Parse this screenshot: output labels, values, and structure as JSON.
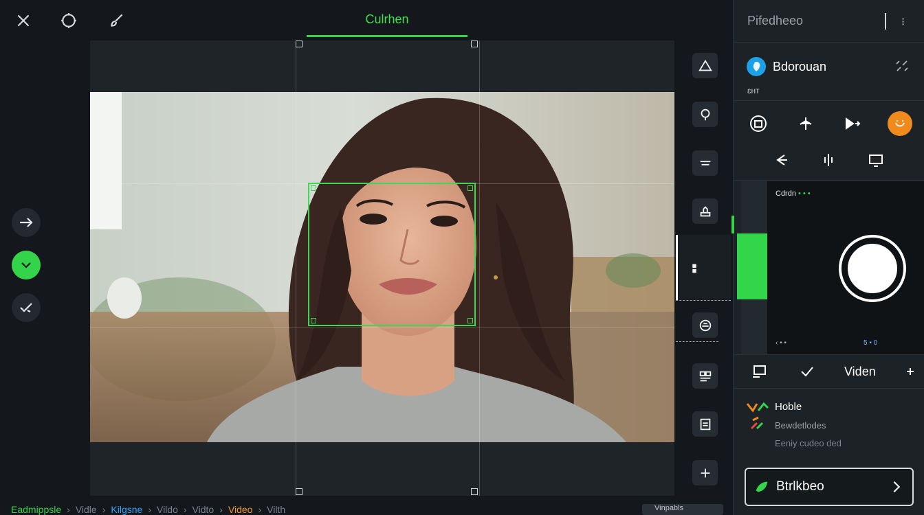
{
  "topbar": {
    "title": "Culrhen",
    "icons": [
      "close-icon",
      "ring-icon",
      "brush-icon"
    ]
  },
  "left_tools": [
    "arrow-right-icon",
    "chevron-down-icon",
    "check-swirl-icon"
  ],
  "right_tools": [
    "triangle-icon",
    "pin-icon",
    "lines-icon",
    "stamp-icon",
    "dots-icon",
    "face-icon",
    "layout-icon",
    "document-icon",
    "plus-icon"
  ],
  "panel": {
    "header": "Pifedheeo",
    "pin_symbol": "⁝",
    "account": {
      "name": "Bdorouan",
      "sub": "ɛнт"
    },
    "tools_row1": [
      "badge-icon",
      "plane-icon",
      "play-cut-icon",
      "smile-icon"
    ],
    "tools_row2": [
      "arrow-left-icon",
      "split-icon",
      "screen-icon"
    ],
    "camera": {
      "label": "Cdrdn",
      "label_dots": "• • •",
      "footer_left": "‹ ▪ ▪",
      "footer_right": "5 ▪ 0"
    },
    "bar": {
      "label": "Viden"
    },
    "note": {
      "title": "Hoble",
      "line2": "Bewdetlodes",
      "line3": "Eeniy cudeo ded"
    },
    "cta": {
      "label": "Btrlkbeo"
    }
  },
  "status_bar": {
    "items": [
      {
        "text": "Eadmippsle",
        "color": "green"
      },
      {
        "text": "›",
        "color": "grey"
      },
      {
        "text": "Vidle",
        "color": "grey"
      },
      {
        "text": "›",
        "color": "grey"
      },
      {
        "text": "Kilgsne",
        "color": "blue"
      },
      {
        "text": "›",
        "color": "grey"
      },
      {
        "text": "Vildo",
        "color": "grey"
      },
      {
        "text": "›",
        "color": "grey"
      },
      {
        "text": "Vidto",
        "color": "grey"
      },
      {
        "text": "›",
        "color": "grey"
      },
      {
        "text": "Video",
        "color": "orange"
      },
      {
        "text": "›",
        "color": "grey"
      },
      {
        "text": "Vilth",
        "color": "grey"
      }
    ],
    "right": "Vinpabls"
  },
  "colors": {
    "accent": "#33d64a",
    "brand_blue": "#1ca0e6",
    "orange": "#f08a1c",
    "background": "#14181c"
  }
}
